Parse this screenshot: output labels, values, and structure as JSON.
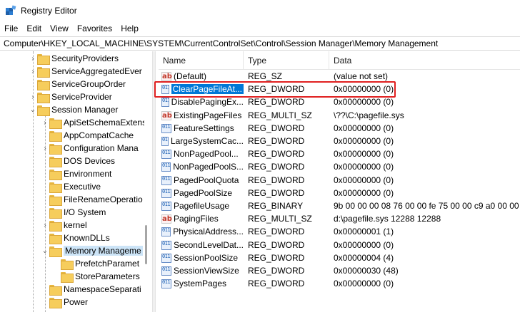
{
  "window": {
    "title": "Registry Editor"
  },
  "menu": [
    "File",
    "Edit",
    "View",
    "Favorites",
    "Help"
  ],
  "address": "Computer\\HKEY_LOCAL_MACHINE\\SYSTEM\\CurrentControlSet\\Control\\Session Manager\\Memory Management",
  "tree": [
    {
      "label": "SecurityProviders",
      "expander": "›"
    },
    {
      "label": "ServiceAggregatedEver",
      "expander": "›"
    },
    {
      "label": "ServiceGroupOrder",
      "expander": ""
    },
    {
      "label": "ServiceProvider",
      "expander": "›"
    },
    {
      "label": "Session Manager",
      "expander": "⌄"
    },
    {
      "label": "ApiSetSchemaExtens",
      "expander": "›"
    },
    {
      "label": "AppCompatCache",
      "expander": ""
    },
    {
      "label": "Configuration Mana",
      "expander": "›"
    },
    {
      "label": "DOS Devices",
      "expander": ""
    },
    {
      "label": "Environment",
      "expander": ""
    },
    {
      "label": "Executive",
      "expander": ""
    },
    {
      "label": "FileRenameOperatio",
      "expander": ""
    },
    {
      "label": "I/O System",
      "expander": ""
    },
    {
      "label": "kernel",
      "expander": "›"
    },
    {
      "label": "KnownDLLs",
      "expander": ""
    },
    {
      "label": "Memory Manageme",
      "expander": "⌄",
      "selected": true
    },
    {
      "label": "PrefetchParamet",
      "expander": ""
    },
    {
      "label": "StoreParameters",
      "expander": ""
    },
    {
      "label": "NamespaceSeparati",
      "expander": ""
    },
    {
      "label": "Power",
      "expander": ""
    }
  ],
  "columns": {
    "name": "Name",
    "type": "Type",
    "data": "Data"
  },
  "values": [
    {
      "icon": "ab",
      "name": "(Default)",
      "type": "REG_SZ",
      "data": "(value not set)"
    },
    {
      "icon": "bin",
      "name": "ClearPageFileAt...",
      "type": "REG_DWORD",
      "data": "0x00000000 (0)",
      "selected": true
    },
    {
      "icon": "bin",
      "name": "DisablePagingEx...",
      "type": "REG_DWORD",
      "data": "0x00000000 (0)"
    },
    {
      "icon": "ab",
      "name": "ExistingPageFiles",
      "type": "REG_MULTI_SZ",
      "data": "\\??\\C:\\pagefile.sys"
    },
    {
      "icon": "bin",
      "name": "FeatureSettings",
      "type": "REG_DWORD",
      "data": "0x00000000 (0)"
    },
    {
      "icon": "bin",
      "name": "LargeSystemCac...",
      "type": "REG_DWORD",
      "data": "0x00000000 (0)"
    },
    {
      "icon": "bin",
      "name": "NonPagedPool...",
      "type": "REG_DWORD",
      "data": "0x00000000 (0)"
    },
    {
      "icon": "bin",
      "name": "NonPagedPoolS...",
      "type": "REG_DWORD",
      "data": "0x00000000 (0)"
    },
    {
      "icon": "bin",
      "name": "PagedPoolQuota",
      "type": "REG_DWORD",
      "data": "0x00000000 (0)"
    },
    {
      "icon": "bin",
      "name": "PagedPoolSize",
      "type": "REG_DWORD",
      "data": "0x00000000 (0)"
    },
    {
      "icon": "bin",
      "name": "PagefileUsage",
      "type": "REG_BINARY",
      "data": "9b 00 00 00 08 76 00 00 fe 75 00 00 c9 a0 00 00 cc 0"
    },
    {
      "icon": "ab",
      "name": "PagingFiles",
      "type": "REG_MULTI_SZ",
      "data": "d:\\pagefile.sys 12288 12288"
    },
    {
      "icon": "bin",
      "name": "PhysicalAddress...",
      "type": "REG_DWORD",
      "data": "0x00000001 (1)"
    },
    {
      "icon": "bin",
      "name": "SecondLevelDat...",
      "type": "REG_DWORD",
      "data": "0x00000000 (0)"
    },
    {
      "icon": "bin",
      "name": "SessionPoolSize",
      "type": "REG_DWORD",
      "data": "0x00000004 (4)"
    },
    {
      "icon": "bin",
      "name": "SessionViewSize",
      "type": "REG_DWORD",
      "data": "0x00000030 (48)"
    },
    {
      "icon": "bin",
      "name": "SystemPages",
      "type": "REG_DWORD",
      "data": "0x00000000 (0)"
    }
  ],
  "colors": {
    "selection": "#0078d7",
    "highlight_outline": "#e02020",
    "folder": "#f6cd5c"
  }
}
